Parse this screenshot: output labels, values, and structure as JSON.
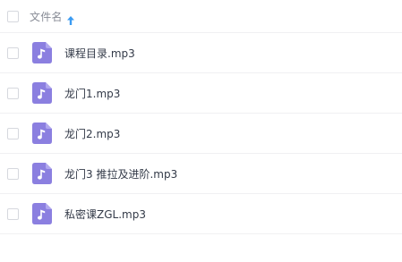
{
  "header": {
    "column_label": "文件名",
    "sort_direction": "ascending",
    "sort_icon": "arrow-up-icon",
    "sort_icon_color": "#3b9bf2"
  },
  "files": [
    {
      "name": "课程目录.mp3",
      "icon": "audio-file-icon"
    },
    {
      "name": "龙门1.mp3",
      "icon": "audio-file-icon"
    },
    {
      "name": "龙门2.mp3",
      "icon": "audio-file-icon"
    },
    {
      "name": "龙门3 推拉及进阶.mp3",
      "icon": "audio-file-icon"
    },
    {
      "name": "私密课ZGL.mp3",
      "icon": "audio-file-icon"
    }
  ],
  "colors": {
    "audio_icon": "#8b7fe0",
    "text": "#333a48",
    "header_text": "#888c96",
    "divider": "#f0f0f2",
    "checkbox_border": "#d6d8de"
  }
}
